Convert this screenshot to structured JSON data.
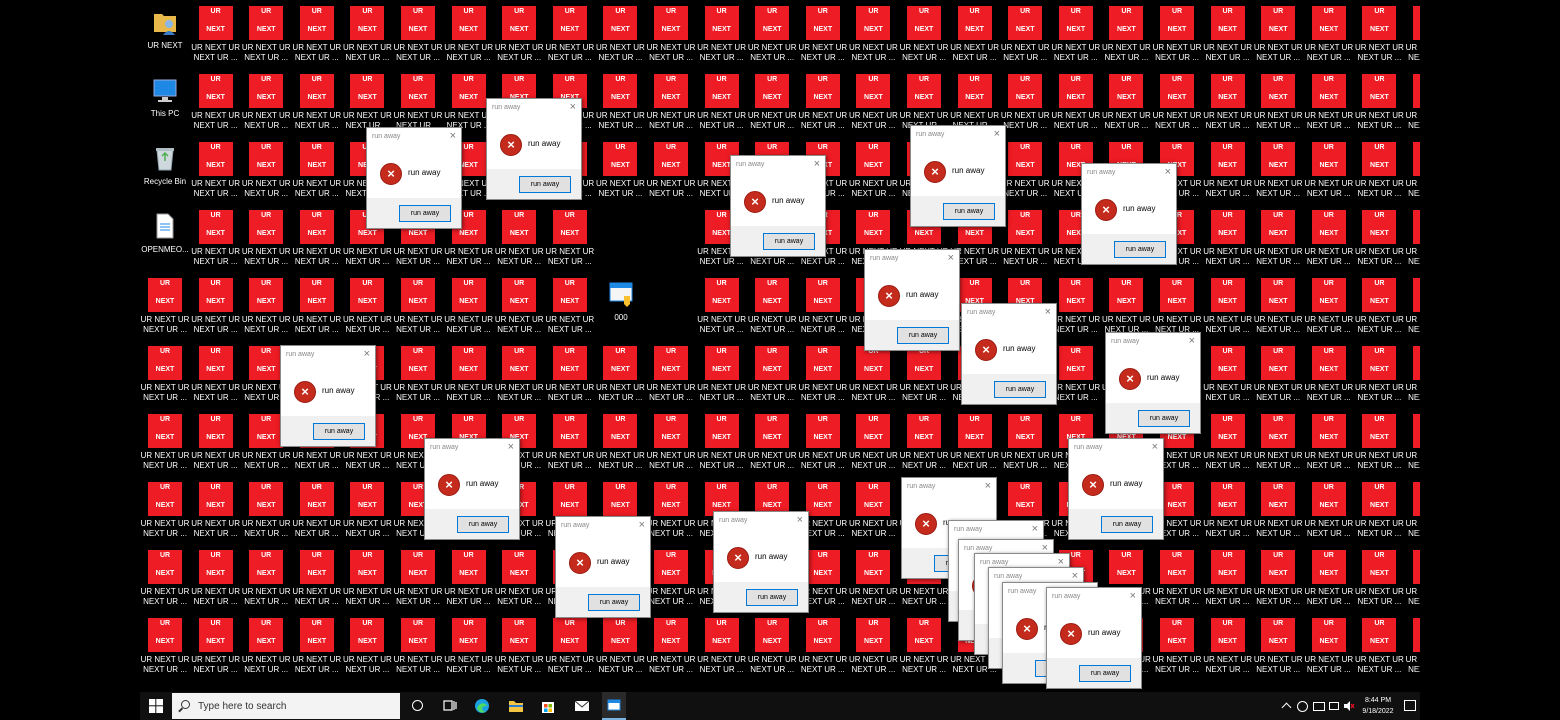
{
  "desktop": {
    "tile_text": "UR NEXT",
    "tile_top": "UR",
    "tile_bottom": "NEXT",
    "icon_label": "UR NEXT UR NEXT UR ...",
    "icon_label_cut": "UR NEXT UR NEXT UR ...",
    "system_icons": {
      "user_folder": "UR NEXT",
      "this_pc": "This PC",
      "recycle_bin": "Recycle Bin",
      "file": "OPENMEO...",
      "app": "000"
    }
  },
  "dialog": {
    "title": "run away",
    "message": "run away",
    "button": "run away",
    "close": "×",
    "error_glyph": "×"
  },
  "taskbar": {
    "search_placeholder": "Type here to search",
    "time": "8:44 PM",
    "date": "9/18/2022"
  },
  "colors": {
    "tile_red": "#ee1c24",
    "desktop_bg": "#000000",
    "taskbar_bg": "#101010",
    "error_red": "#c42b1c",
    "button_border": "#0078d7"
  }
}
